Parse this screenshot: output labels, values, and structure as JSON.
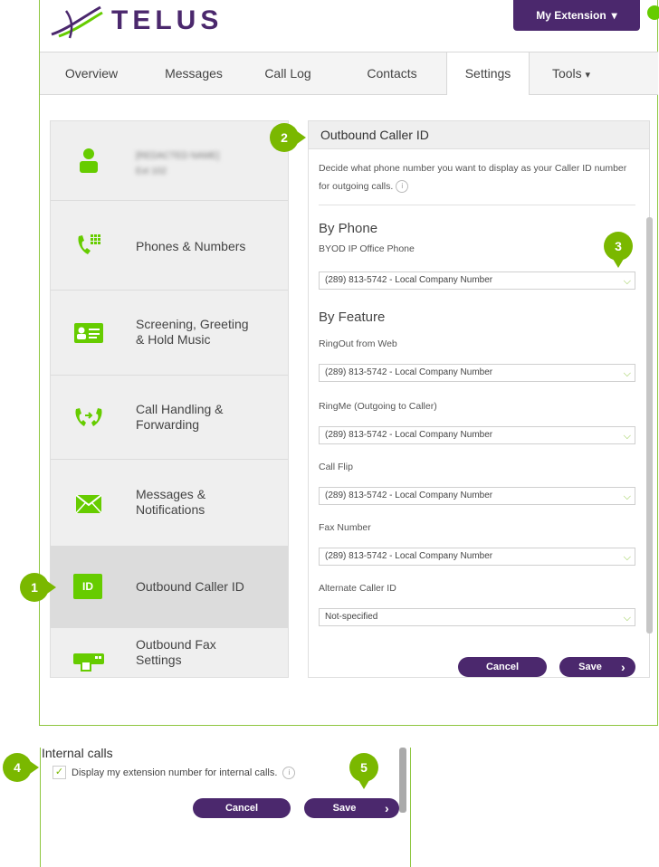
{
  "header": {
    "logo_text": "TELUS",
    "extension_button": "My Extension",
    "extension_caret": "▾"
  },
  "nav": {
    "tabs": [
      {
        "label": "Overview"
      },
      {
        "label": "Messages"
      },
      {
        "label": "Call Log"
      },
      {
        "label": "Contacts"
      },
      {
        "label": "Settings"
      },
      {
        "label": "Tools"
      }
    ],
    "active": "Settings",
    "tools_caret": "▾"
  },
  "menu": {
    "user_name_line1": "[REDACTED NAME]",
    "user_name_line2": "Ext 102",
    "items": [
      {
        "label": "Phones & Numbers",
        "icon": "phone-keypad-icon"
      },
      {
        "label": "Screening, Greeting\n& Hold Music",
        "icon": "id-card-icon"
      },
      {
        "label": "Call Handling &\nForwarding",
        "icon": "call-forward-icon"
      },
      {
        "label": "Messages &\nNotifications",
        "icon": "envelope-icon"
      },
      {
        "label": "Outbound Caller ID",
        "icon": "id-badge-icon",
        "icon_text": "ID",
        "active": true
      },
      {
        "label": "Outbound Fax\nSettings",
        "icon": "fax-icon"
      }
    ]
  },
  "panel": {
    "title": "Outbound Caller ID",
    "description": "Decide what phone number you want to display as your Caller ID number for outgoing calls.",
    "info_glyph": "i",
    "by_phone": {
      "heading": "By Phone",
      "device_label": "BYOD IP Office Phone",
      "device_value": "(289) 813-5742 - Local Company Number"
    },
    "by_feature": {
      "heading": "By Feature",
      "fields": [
        {
          "label": "RingOut from Web",
          "value": "(289) 813-5742 - Local Company Number"
        },
        {
          "label": "RingMe (Outgoing to Caller)",
          "value": "(289) 813-5742 - Local Company Number"
        },
        {
          "label": "Call Flip",
          "value": "(289) 813-5742 - Local Company Number"
        },
        {
          "label": "Fax Number",
          "value": "(289) 813-5742 - Local Company Number"
        },
        {
          "label": "Alternate Caller ID",
          "value": "Not-specified"
        }
      ]
    },
    "cancel_label": "Cancel",
    "save_label": "Save",
    "save_arrow": "›"
  },
  "internal": {
    "title": "Internal calls",
    "checkbox_label": "Display my extension number for internal calls.",
    "checked": true,
    "check_glyph": "✓",
    "cancel_label": "Cancel",
    "save_label": "Save",
    "save_arrow": "›"
  },
  "callouts": [
    "1",
    "2",
    "3",
    "4",
    "5"
  ],
  "colors": {
    "brand_purple": "#4b286d",
    "brand_green": "#66cc00",
    "callout_green": "#7ab800"
  }
}
